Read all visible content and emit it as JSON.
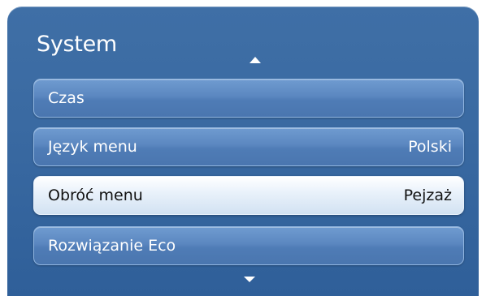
{
  "menu": {
    "title": "System",
    "items": [
      {
        "label": "Czas",
        "value": ""
      },
      {
        "label": "Język menu",
        "value": "Polski"
      },
      {
        "label": "Obróć menu",
        "value": "Pejzaż",
        "selected": true
      },
      {
        "label": "Rozwiązanie Eco",
        "value": ""
      }
    ]
  },
  "colors": {
    "panel": "#3a6aa2",
    "item": "#5b87c0",
    "selected_item": "#eaf2fb",
    "text": "#ffffff",
    "selected_text": "#111111"
  },
  "icons": {
    "scroll_up": "triangle-up",
    "scroll_down": "triangle-down"
  }
}
